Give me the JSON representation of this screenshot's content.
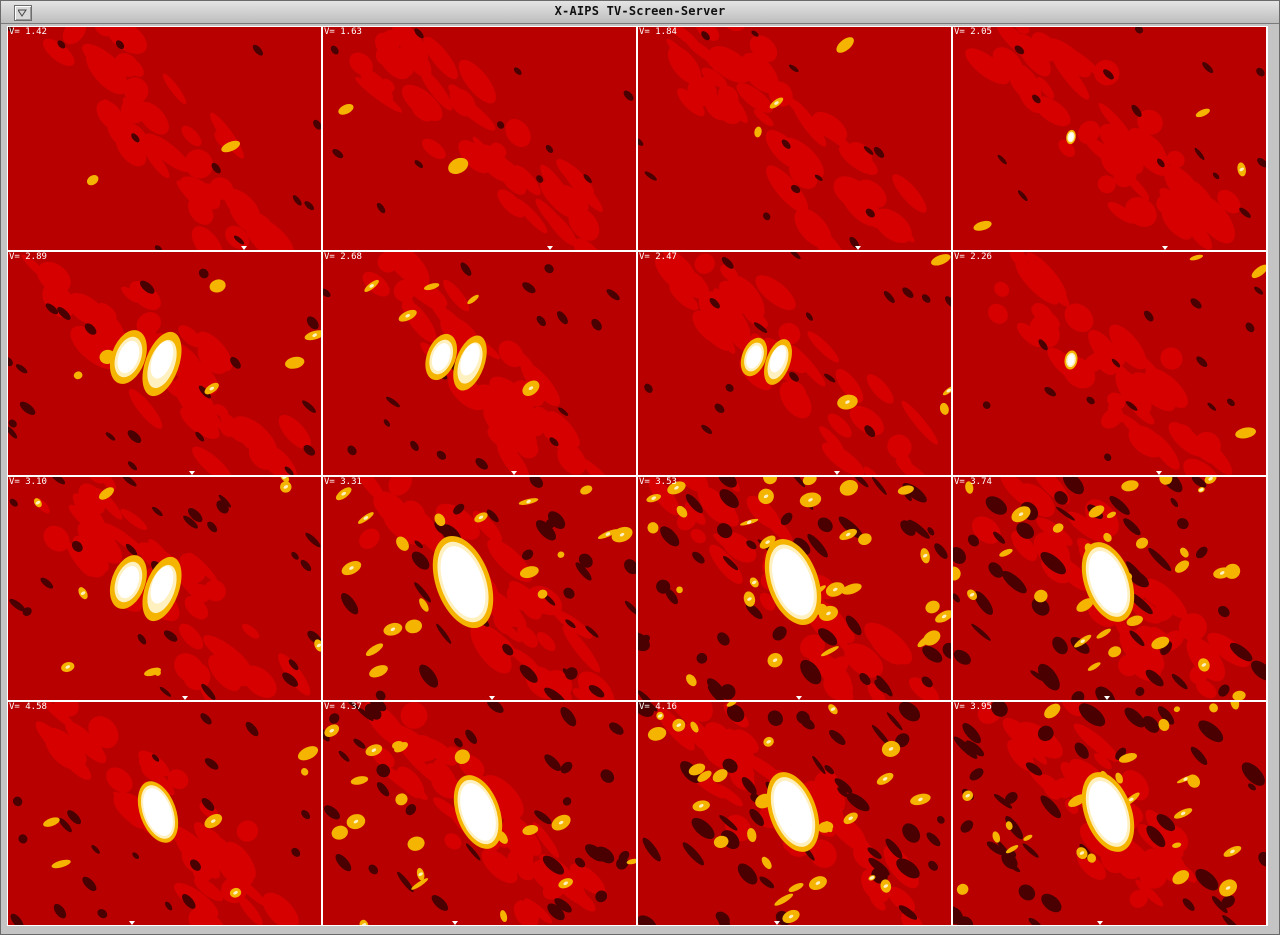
{
  "window": {
    "title": "X-AIPS TV-Screen-Server",
    "menu_icon": "triangle-down-icon"
  },
  "colors": {
    "background": "#b90000",
    "level1": "#d60000",
    "dark": "#4a0000",
    "yellow": "#f5b400",
    "pale": "#fff0c0",
    "white": "#ffffff",
    "grid": "#ffffff"
  },
  "channels": [
    {
      "label": "V= 1.42"
    },
    {
      "label": "V= 1.63"
    },
    {
      "label": "V= 1.84"
    },
    {
      "label": "V= 2.05"
    },
    {
      "label": "V= 2.89"
    },
    {
      "label": "V= 2.68"
    },
    {
      "label": "V= 2.47"
    },
    {
      "label": "V= 2.26"
    },
    {
      "label": "V= 3.10"
    },
    {
      "label": "V= 3.31"
    },
    {
      "label": "V= 3.53"
    },
    {
      "label": "V= 3.74"
    },
    {
      "label": "V= 4.58"
    },
    {
      "label": "V= 4.37"
    },
    {
      "label": "V= 4.16"
    },
    {
      "label": "V= 3.95"
    }
  ]
}
